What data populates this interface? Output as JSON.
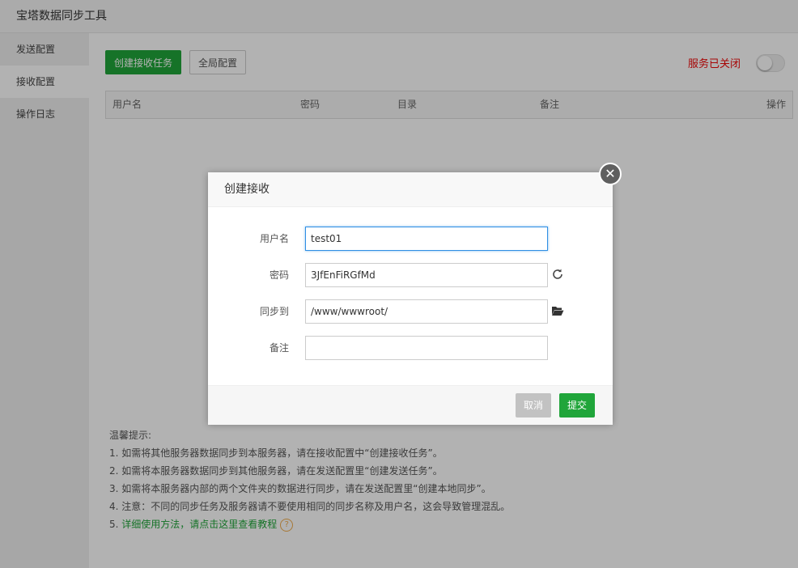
{
  "window": {
    "title": "宝塔数据同步工具"
  },
  "sidebar": {
    "items": [
      {
        "label": "发送配置"
      },
      {
        "label": "接收配置"
      },
      {
        "label": "操作日志"
      }
    ]
  },
  "toolbar": {
    "create_label": "创建接收任务",
    "global_label": "全局配置",
    "service_status": "服务已关闭"
  },
  "table": {
    "columns": [
      "用户名",
      "密码",
      "目录",
      "备注",
      "操作"
    ]
  },
  "tips": {
    "heading": "温馨提示:",
    "lines": [
      "1. 如需将其他服务器数据同步到本服务器，请在接收配置中“创建接收任务”。",
      "2. 如需将本服务器数据同步到其他服务器，请在发送配置里“创建发送任务”。",
      "3. 如需将本服务器内部的两个文件夹的数据进行同步，请在发送配置里“创建本地同步”。",
      "4. 注意：不同的同步任务及服务器请不要使用相同的同步名称及用户名，这会导致管理混乱。"
    ],
    "line5_prefix": "5. ",
    "help_link": "详细使用方法，请点击这里查看教程",
    "help_icon_glyph": "?"
  },
  "dialog": {
    "title": "创建接收",
    "close_glyph": "✕",
    "fields": [
      {
        "label": "用户名",
        "value": "test01"
      },
      {
        "label": "密码",
        "value": "3JfEnFiRGfMd"
      },
      {
        "label": "同步到",
        "value": "/www/wwwroot/"
      },
      {
        "label": "备注",
        "value": ""
      }
    ],
    "cancel_label": "取消",
    "submit_label": "提交"
  },
  "colors": {
    "accent": "#20a53a",
    "status_off": "#ef0808",
    "cancel_disabled": "#c2c2c2"
  },
  "icons": {
    "refresh": "refresh-icon",
    "folder": "folder-open-icon"
  }
}
